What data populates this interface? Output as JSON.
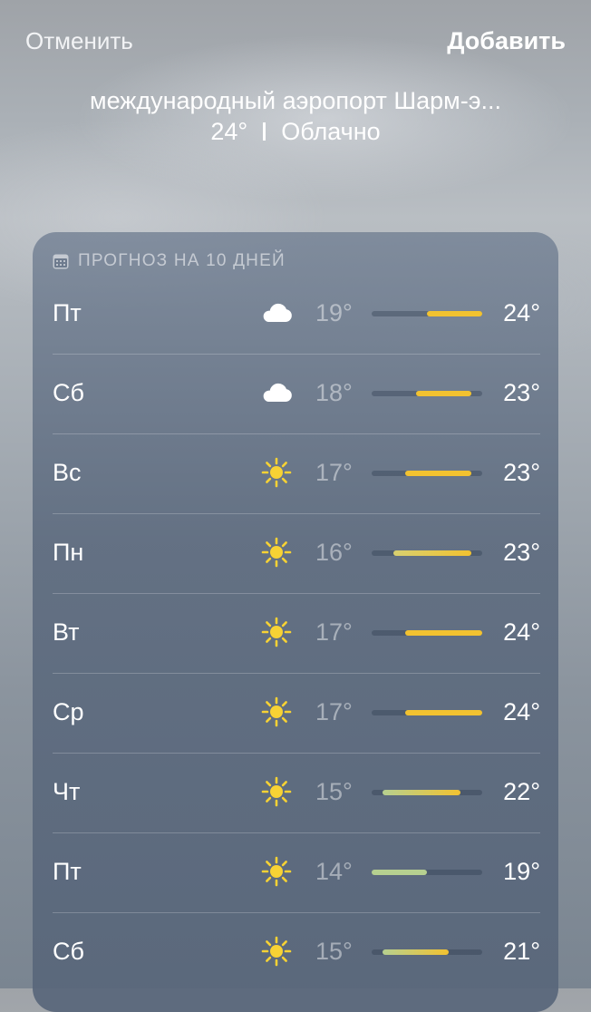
{
  "header": {
    "cancel_label": "Отменить",
    "add_label": "Добавить"
  },
  "location": {
    "name": "международный аэропорт Шарм-э...",
    "temperature": "24°",
    "condition": "Облачно"
  },
  "forecast": {
    "title": "ПРОГНОЗ НА 10 ДНЕЙ",
    "scale": {
      "min": 14,
      "max": 24
    },
    "colors": {
      "warm": "#f2c230",
      "cool": "#b6d090",
      "track": "rgba(40,55,75,0.35)"
    },
    "days": [
      {
        "day": "Пт",
        "icon": "cloud-icon",
        "low": "19°",
        "high": "24°",
        "low_val": 19,
        "high_val": 24
      },
      {
        "day": "Сб",
        "icon": "cloud-icon",
        "low": "18°",
        "high": "23°",
        "low_val": 18,
        "high_val": 23
      },
      {
        "day": "Вс",
        "icon": "sun-icon",
        "low": "17°",
        "high": "23°",
        "low_val": 17,
        "high_val": 23
      },
      {
        "day": "Пн",
        "icon": "sun-icon",
        "low": "16°",
        "high": "23°",
        "low_val": 16,
        "high_val": 23
      },
      {
        "day": "Вт",
        "icon": "sun-icon",
        "low": "17°",
        "high": "24°",
        "low_val": 17,
        "high_val": 24
      },
      {
        "day": "Ср",
        "icon": "sun-icon",
        "low": "17°",
        "high": "24°",
        "low_val": 17,
        "high_val": 24
      },
      {
        "day": "Чт",
        "icon": "sun-icon",
        "low": "15°",
        "high": "22°",
        "low_val": 15,
        "high_val": 22
      },
      {
        "day": "Пт",
        "icon": "sun-icon",
        "low": "14°",
        "high": "19°",
        "low_val": 14,
        "high_val": 19
      },
      {
        "day": "Сб",
        "icon": "sun-icon",
        "low": "15°",
        "high": "21°",
        "low_val": 15,
        "high_val": 21
      }
    ]
  }
}
